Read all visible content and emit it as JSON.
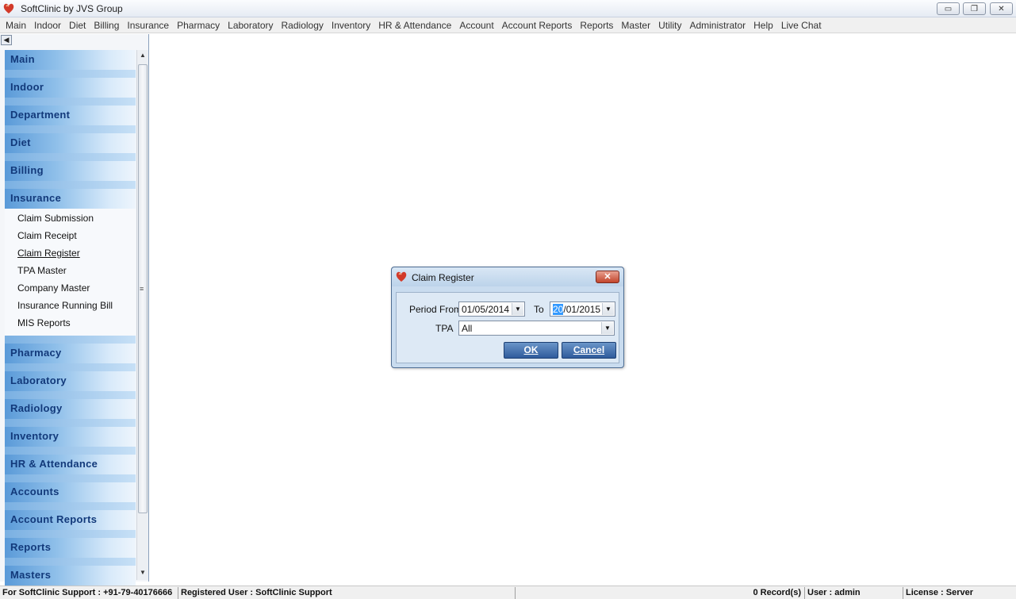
{
  "window": {
    "title": "SoftClinic by JVS Group",
    "minimize_glyph": "▭",
    "restore_glyph": "❐",
    "close_glyph": "✕"
  },
  "menu": [
    "Main",
    "Indoor",
    "Diet",
    "Billing",
    "Insurance",
    "Pharmacy",
    "Laboratory",
    "Radiology",
    "Inventory",
    "HR & Attendance",
    "Account",
    "Account Reports",
    "Reports",
    "Master",
    "Utility",
    "Administrator",
    "Help",
    "Live Chat"
  ],
  "sidebar": {
    "collapse_glyph": "◀",
    "sections_before": [
      "Main",
      "Indoor",
      "Department",
      "Diet",
      "Billing"
    ],
    "expanded_section": "Insurance",
    "expanded_items": [
      "Claim Submission",
      "Claim Receipt",
      "Claim Register",
      "TPA Master",
      "Company Master",
      "Insurance Running Bill",
      "MIS Reports"
    ],
    "active_item": "Claim Register",
    "sections_after": [
      "Pharmacy",
      "Laboratory",
      "Radiology",
      "Inventory",
      "HR & Attendance",
      "Accounts",
      "Account Reports",
      "Reports",
      "Masters"
    ],
    "scroll_up_glyph": "▲",
    "scroll_down_glyph": "▼",
    "scroll_grip_glyph": "≡"
  },
  "dialog": {
    "title": "Claim Register",
    "close_glyph": "✕",
    "period_from_label": "Period From",
    "period_from_value": "01/05/2014",
    "to_label": "To",
    "to_value_selected": "20",
    "to_value_rest": "/01/2015",
    "tpa_label": "TPA",
    "tpa_value": "All",
    "dropdown_glyph": "▼",
    "ok_label": "OK",
    "cancel_label": "Cancel"
  },
  "statusbar": {
    "support": "For SoftClinic Support : +91-79-40176666",
    "registered_user": "Registered User : SoftClinic Support",
    "records": "0 Record(s)",
    "user": "User : admin",
    "license": "License : Server"
  },
  "colors": {
    "nav_header_text": "#12397a",
    "dialog_bg": "#c9dcef",
    "button_blue": "#2f5b9c",
    "close_red": "#c2452c",
    "selection": "#3399ff"
  },
  "icons": {
    "app": "heart-logo-icon",
    "dialog": "heart-logo-icon"
  }
}
